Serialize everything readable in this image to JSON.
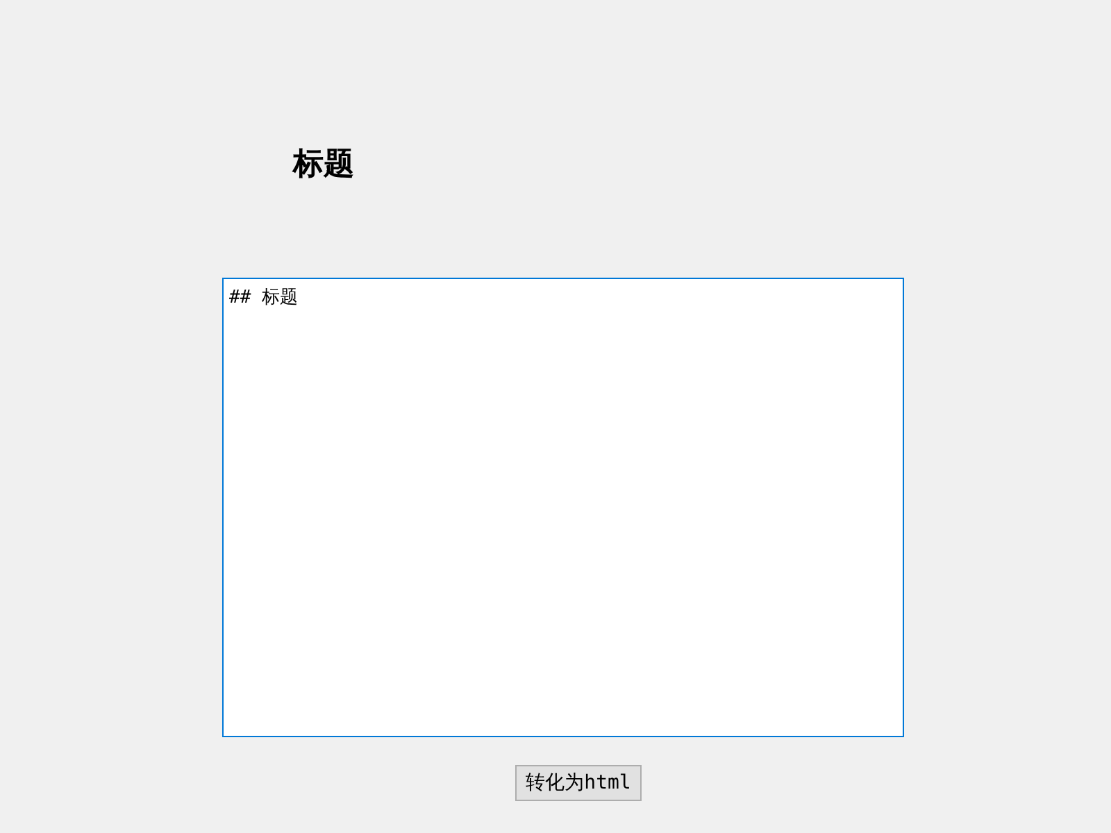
{
  "heading": "标题",
  "editor": {
    "value": "## 标题",
    "focused": true
  },
  "button": {
    "label": "转化为html"
  }
}
